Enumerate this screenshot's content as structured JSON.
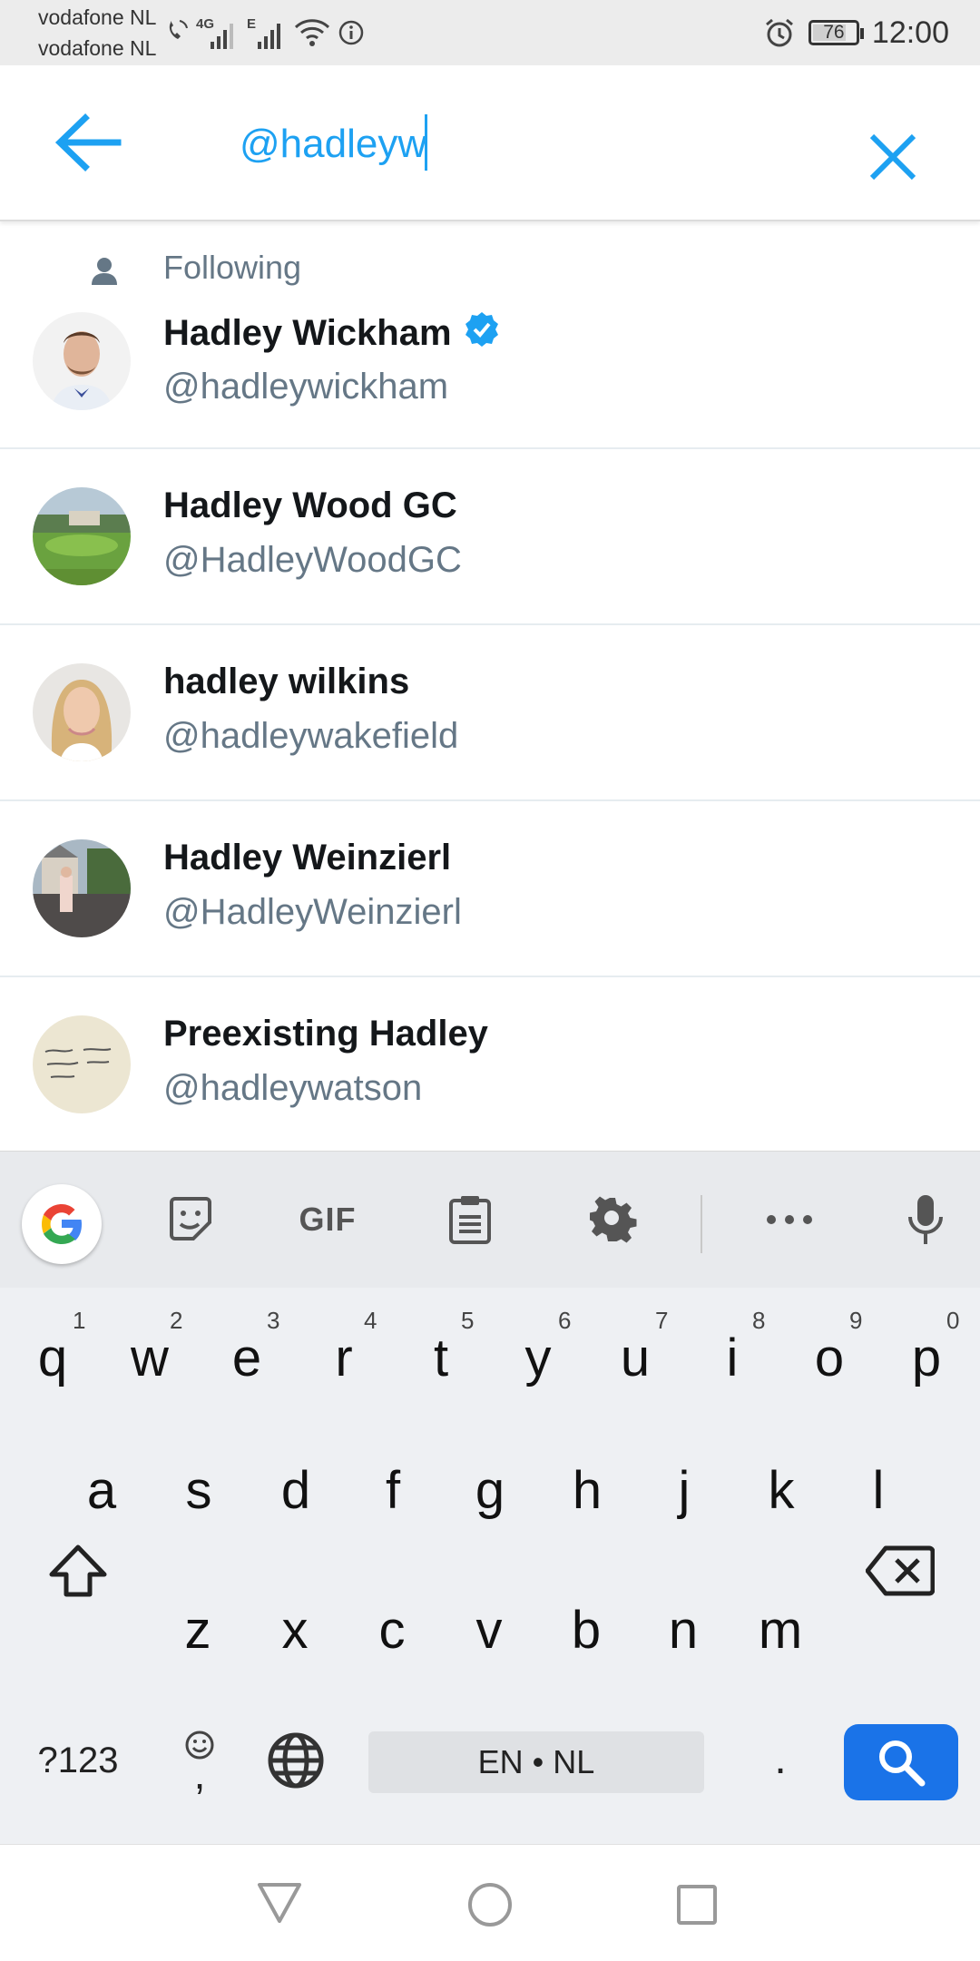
{
  "status_bar": {
    "carrier_1": "vodafone NL",
    "carrier_2": "vodafone NL",
    "network_1": "4G",
    "network_2": "E",
    "battery": "76",
    "time": "12:00"
  },
  "search": {
    "value": "@hadleyw",
    "back_icon": "arrow-left-icon",
    "clear_icon": "close-icon",
    "accent_color": "#1da1f2"
  },
  "results": {
    "following_label": "Following",
    "items": [
      {
        "name": "Hadley Wickham",
        "handle": "@hadleywickham",
        "verified": true
      },
      {
        "name": "Hadley Wood GC",
        "handle": "@HadleyWoodGC",
        "verified": false
      },
      {
        "name": "hadley wilkins",
        "handle": "@hadleywakefield",
        "verified": false
      },
      {
        "name": "Hadley Weinzierl",
        "handle": "@HadleyWeinzierl",
        "verified": false
      },
      {
        "name": "Preexisting Hadley",
        "handle": "@hadleywatson",
        "verified": false
      }
    ]
  },
  "keyboard": {
    "toolbar": {
      "gif": "GIF"
    },
    "row1": [
      "q",
      "w",
      "e",
      "r",
      "t",
      "y",
      "u",
      "i",
      "o",
      "p"
    ],
    "row1_hints": [
      "1",
      "2",
      "3",
      "4",
      "5",
      "6",
      "7",
      "8",
      "9",
      "0"
    ],
    "row2": [
      "a",
      "s",
      "d",
      "f",
      "g",
      "h",
      "j",
      "k",
      "l"
    ],
    "row3": [
      "z",
      "x",
      "c",
      "v",
      "b",
      "n",
      "m"
    ],
    "symbols_label": "?123",
    "comma_label": ",",
    "space_label": "EN • NL",
    "period_label": "."
  }
}
